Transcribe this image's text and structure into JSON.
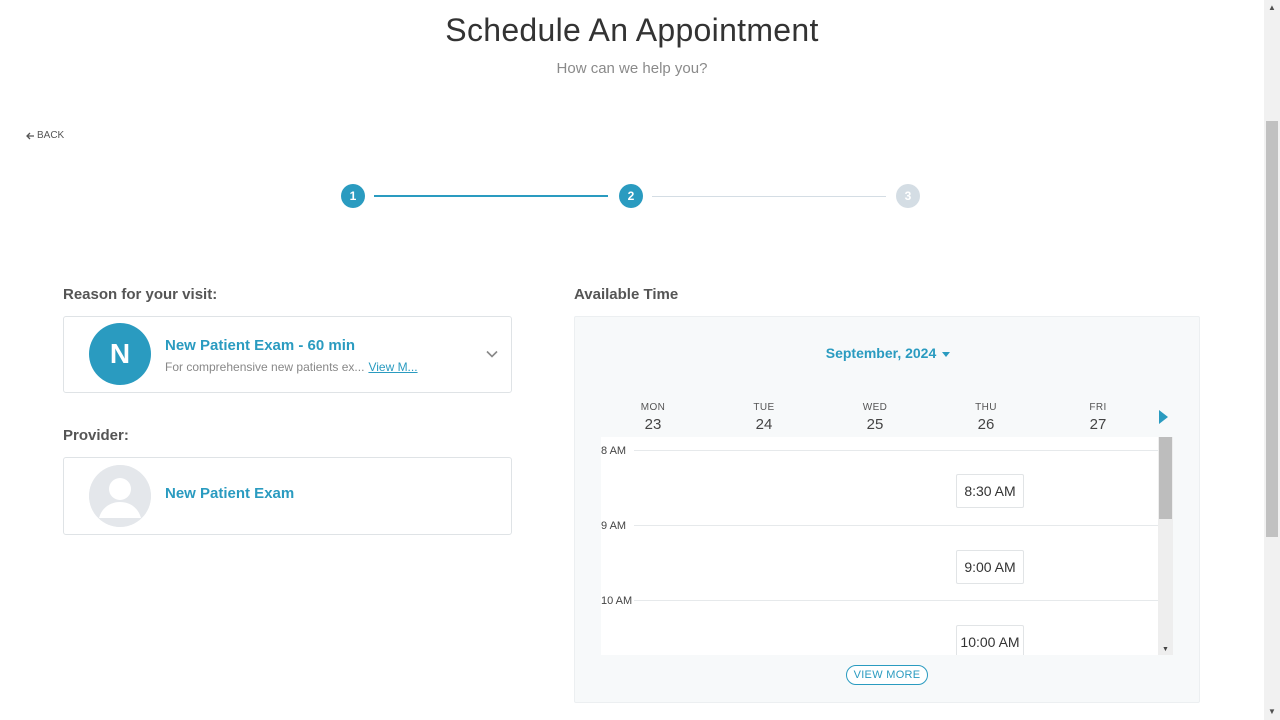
{
  "header": {
    "title": "Schedule An Appointment",
    "subtitle": "How can we help you?"
  },
  "back_label": "BACK",
  "stepper": {
    "steps": [
      "1",
      "2",
      "3"
    ],
    "current_step": 2
  },
  "reason": {
    "label": "Reason for your visit:",
    "avatar_letter": "N",
    "title": "New Patient Exam - 60 min",
    "description": "For comprehensive new patients ex...",
    "link": "View M..."
  },
  "provider": {
    "label": "Provider:",
    "name": "New Patient Exam"
  },
  "calendar": {
    "label": "Available Time",
    "month": "September, 2024",
    "days": [
      {
        "dow": "MON",
        "num": "23"
      },
      {
        "dow": "TUE",
        "num": "24"
      },
      {
        "dow": "WED",
        "num": "25"
      },
      {
        "dow": "THU",
        "num": "26"
      },
      {
        "dow": "FRI",
        "num": "27"
      }
    ],
    "hours": [
      "8 AM",
      "9 AM",
      "10 AM"
    ],
    "slots": [
      "8:30 AM",
      "9:00 AM",
      "10:00 AM"
    ],
    "view_more": "VIEW MORE"
  },
  "colors": {
    "accent": "#2a9bc0",
    "inactive": "#d4dde4"
  }
}
